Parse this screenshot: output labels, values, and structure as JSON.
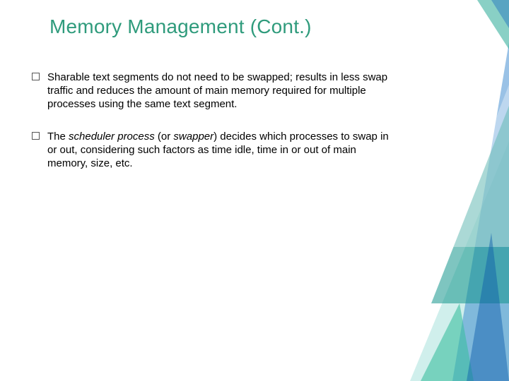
{
  "slide": {
    "title": "Memory Management (Cont.)",
    "bullets": [
      {
        "plain_pre": "Sharable text segments do not need to be swapped; results in less swap traffic and reduces the amount of main memory required for multiple processes using the same text segment.",
        "em1": "",
        "mid": "",
        "em2": "",
        "plain_post": ""
      },
      {
        "plain_pre": "The ",
        "em1": "scheduler process",
        "mid": " (or ",
        "em2": "swapper",
        "plain_post": ") decides which processes to swap in or out, considering such factors as time idle, time in or out of main memory, size, etc."
      }
    ]
  }
}
